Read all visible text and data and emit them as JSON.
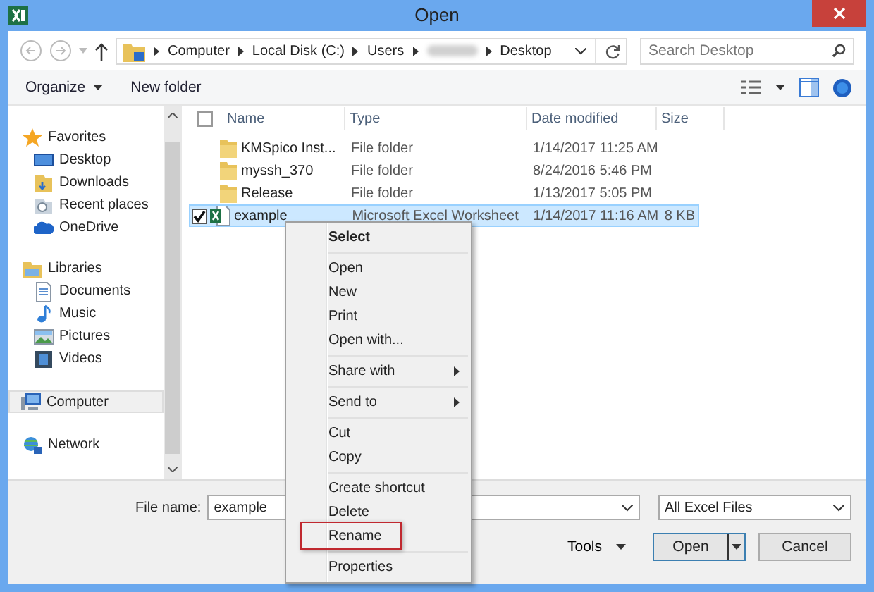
{
  "window": {
    "title": "Open"
  },
  "address": {
    "segments": [
      {
        "kind": "text",
        "label": "Computer"
      },
      {
        "kind": "text",
        "label": "Local Disk (C:)"
      },
      {
        "kind": "text",
        "label": "Users"
      },
      {
        "kind": "blurred"
      },
      {
        "kind": "text",
        "label": "Desktop"
      }
    ]
  },
  "search": {
    "placeholder": "Search Desktop"
  },
  "toolbar": [
    {
      "label": "Organize",
      "dropdown": true
    },
    {
      "label": "New folder",
      "dropdown": false
    }
  ],
  "sidebar": {
    "items": [
      {
        "label": "Favorites",
        "selected": false,
        "children": [
          {
            "label": "Desktop",
            "selected": false
          },
          {
            "label": "Downloads",
            "selected": false
          },
          {
            "label": "Recent places",
            "selected": false
          },
          {
            "label": "OneDrive",
            "selected": false
          }
        ]
      },
      {
        "label": "Libraries",
        "selected": false,
        "children": [
          {
            "label": "Documents",
            "selected": false
          },
          {
            "label": "Music",
            "selected": false
          },
          {
            "label": "Pictures",
            "selected": false
          },
          {
            "label": "Videos",
            "selected": false
          }
        ]
      },
      {
        "label": "Computer",
        "selected": true
      },
      {
        "label": "Network",
        "selected": false
      }
    ]
  },
  "table": {
    "select_all_checked": false,
    "columns": [
      "Name",
      "Type",
      "Date modified",
      "Size"
    ],
    "rows": [
      {
        "kind": "folder",
        "name": "KMSpico Inst...",
        "type": "File folder",
        "date": "1/14/2017 11:25 AM",
        "selected": false,
        "checked": false
      },
      {
        "kind": "folder",
        "name": "myssh_370",
        "type": "File folder",
        "date": "8/24/2016 5:46 PM",
        "selected": false,
        "checked": false
      },
      {
        "kind": "folder",
        "name": "Release",
        "type": "File folder",
        "date": "1/13/2017 5:05 PM",
        "selected": false,
        "checked": false
      },
      {
        "kind": "excel",
        "name": "example",
        "type": "Microsoft Excel Worksheet",
        "date": "1/14/2017 11:16 AM",
        "size": "8 KB",
        "selected": true,
        "checked": true
      }
    ]
  },
  "context_menu": {
    "items": [
      {
        "kind": "header",
        "label": "Select"
      },
      {
        "kind": "separator"
      },
      {
        "kind": "item",
        "label": "Open"
      },
      {
        "kind": "item",
        "label": "New"
      },
      {
        "kind": "item",
        "label": "Print"
      },
      {
        "kind": "item",
        "label": "Open with..."
      },
      {
        "kind": "separator"
      },
      {
        "kind": "submenu",
        "label": "Share with"
      },
      {
        "kind": "separator"
      },
      {
        "kind": "submenu",
        "label": "Send to"
      },
      {
        "kind": "separator"
      },
      {
        "kind": "item",
        "label": "Cut"
      },
      {
        "kind": "item",
        "label": "Copy"
      },
      {
        "kind": "separator"
      },
      {
        "kind": "item",
        "label": "Create shortcut"
      },
      {
        "kind": "item",
        "label": "Delete"
      },
      {
        "kind": "item",
        "label": "Rename",
        "annotated": true
      },
      {
        "kind": "separator"
      },
      {
        "kind": "item",
        "label": "Properties"
      }
    ]
  },
  "footer": {
    "file_name_label": "File name:",
    "file_name": "example",
    "file_type": "All Excel Files",
    "tools": "Tools",
    "open": "Open",
    "cancel": "Cancel"
  }
}
